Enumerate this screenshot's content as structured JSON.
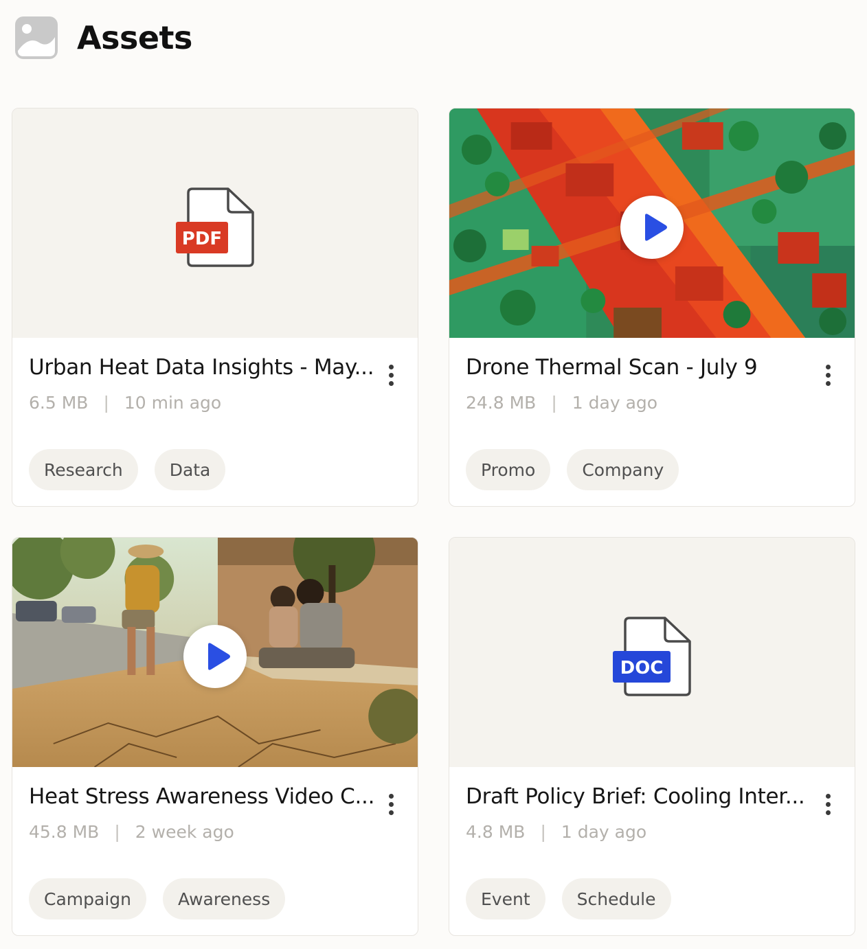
{
  "page": {
    "title": "Assets",
    "icon": "image-icon"
  },
  "assets": [
    {
      "title": "Urban Heat Data Insights - May...",
      "size": "6.5 MB",
      "time": "10 min ago",
      "type": "pdf",
      "badge": "PDF",
      "tags": [
        "Research",
        "Data"
      ]
    },
    {
      "title": "Drone Thermal Scan - July 9",
      "size": "24.8 MB",
      "time": "1 day ago",
      "type": "video",
      "tags": [
        "Promo",
        "Company"
      ]
    },
    {
      "title": "Heat Stress Awareness Video C...",
      "size": "45.8 MB",
      "time": "2 week ago",
      "type": "video",
      "tags": [
        "Campaign",
        "Awareness"
      ]
    },
    {
      "title": "Draft Policy Brief: Cooling Inter...",
      "size": "4.8 MB",
      "time": "1 day ago",
      "type": "doc",
      "badge": "DOC",
      "tags": [
        "Event",
        "Schedule"
      ]
    }
  ],
  "meta_separator": "|",
  "colors": {
    "pdf_badge": "#d93a24",
    "doc_badge": "#2547d9",
    "play_icon": "#2a4fe3",
    "tag_bg": "#f3f1ec"
  }
}
